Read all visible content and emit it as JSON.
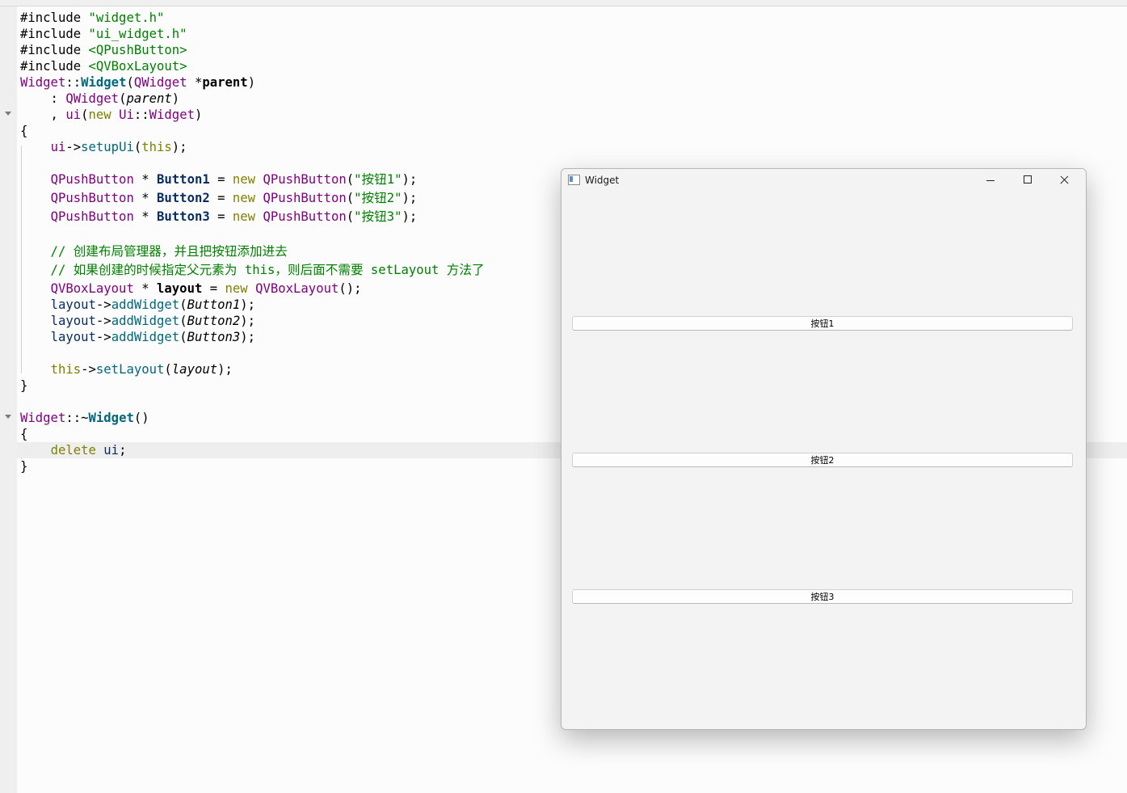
{
  "code": {
    "l1": {
      "a": "#include ",
      "b": "\"widget.h\""
    },
    "l2": {
      "a": "#include ",
      "b": "\"ui_widget.h\""
    },
    "l3": {
      "a": "#include ",
      "b": "<QPushButton>"
    },
    "l4": {
      "a": "#include ",
      "b": "<QVBoxLayout>"
    },
    "l5": {
      "a": "Widget",
      "b": "::",
      "c": "Widget",
      "d": "(",
      "e": "QWidget",
      "f": " *",
      "g": "parent",
      "h": ")"
    },
    "l6": {
      "a": "    : ",
      "b": "QWidget",
      "c": "(",
      "d": "parent",
      "e": ")"
    },
    "l7": {
      "a": "    , ",
      "b": "ui",
      "c": "(",
      "d": "new",
      "e": " ",
      "f": "Ui",
      "g": "::",
      "h": "Widget",
      "i": ")"
    },
    "l8": "{",
    "l9": {
      "a": "    ",
      "b": "ui",
      "c": "->",
      "d": "setupUi",
      "e": "(",
      "f": "this",
      "g": ");"
    },
    "l10": {
      "a": "    ",
      "b": "QPushButton",
      "c": " * ",
      "d": "Button1",
      "e": " = ",
      "f": "new",
      "g": " ",
      "h": "QPushButton",
      "i": "(",
      "j": "\"按钮1\"",
      "k": ");"
    },
    "l11": {
      "a": "    ",
      "b": "QPushButton",
      "c": " * ",
      "d": "Button2",
      "e": " = ",
      "f": "new",
      "g": " ",
      "h": "QPushButton",
      "i": "(",
      "j": "\"按钮2\"",
      "k": ");"
    },
    "l12": {
      "a": "    ",
      "b": "QPushButton",
      "c": " * ",
      "d": "Button3",
      "e": " = ",
      "f": "new",
      "g": " ",
      "h": "QPushButton",
      "i": "(",
      "j": "\"按钮3\"",
      "k": ");"
    },
    "l13": "    // 创建布局管理器，并且把按钮添加进去",
    "l14": "    // 如果创建的时候指定父元素为 this，则后面不需要 setLayout 方法了",
    "l15": {
      "a": "    ",
      "b": "QVBoxLayout",
      "c": " * ",
      "d": "layout",
      "e": " = ",
      "f": "new",
      "g": " ",
      "h": "QVBoxLayout",
      "i": "();"
    },
    "l16": {
      "a": "    ",
      "b": "layout",
      "c": "->",
      "d": "addWidget",
      "e": "(",
      "f": "Button1",
      "g": ");"
    },
    "l17": {
      "a": "    ",
      "b": "layout",
      "c": "->",
      "d": "addWidget",
      "e": "(",
      "f": "Button2",
      "g": ");"
    },
    "l18": {
      "a": "    ",
      "b": "layout",
      "c": "->",
      "d": "addWidget",
      "e": "(",
      "f": "Button3",
      "g": ");"
    },
    "l19": {
      "a": "    ",
      "b": "this",
      "c": "->",
      "d": "setLayout",
      "e": "(",
      "f": "layout",
      "g": ");"
    },
    "l20": "}",
    "l21": {
      "a": "Widget",
      "b": "::~",
      "c": "Widget",
      "d": "()"
    },
    "l22": "{",
    "l23": {
      "a": "    ",
      "b": "delete",
      "c": " ",
      "d": "ui",
      "e": ";"
    },
    "l24": "}"
  },
  "window": {
    "title": "Widget",
    "buttons": [
      "按钮1",
      "按钮2",
      "按钮3"
    ],
    "controls": {
      "minimize": "minimize",
      "maximize": "maximize",
      "close": "close"
    }
  }
}
